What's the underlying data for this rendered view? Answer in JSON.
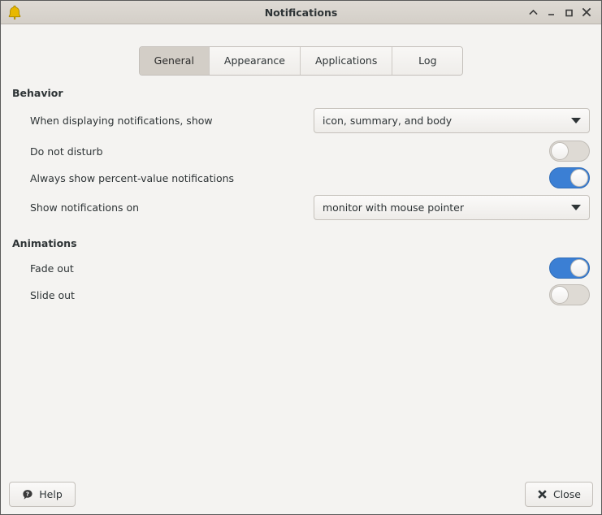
{
  "window": {
    "title": "Notifications",
    "icon": "bell-icon",
    "controls": [
      {
        "name": "shade-button",
        "glyph": "^"
      },
      {
        "name": "minimize-button",
        "glyph": "_"
      },
      {
        "name": "maximize-button",
        "glyph": "□"
      },
      {
        "name": "close-button",
        "glyph": "✕"
      }
    ]
  },
  "tabs": [
    {
      "label": "General",
      "active": true
    },
    {
      "label": "Appearance",
      "active": false
    },
    {
      "label": "Applications",
      "active": false
    },
    {
      "label": "Log",
      "active": false
    }
  ],
  "sections": {
    "behavior": {
      "title": "Behavior",
      "rows": {
        "display_show": {
          "label": "When displaying notifications, show",
          "control": "combobox",
          "value": "icon, summary, and body"
        },
        "do_not_disturb": {
          "label": "Do not disturb",
          "control": "switch",
          "value": "off"
        },
        "percent_value": {
          "label": "Always show percent-value notifications",
          "control": "switch",
          "value": "on"
        },
        "show_on": {
          "label": "Show notifications on",
          "control": "combobox",
          "value": "monitor with mouse pointer"
        }
      }
    },
    "animations": {
      "title": "Animations",
      "rows": {
        "fade_out": {
          "label": "Fade out",
          "control": "switch",
          "value": "on"
        },
        "slide_out": {
          "label": "Slide out",
          "control": "switch",
          "value": "off"
        }
      }
    }
  },
  "footer": {
    "help_label": "Help",
    "close_label": "Close"
  },
  "colors": {
    "accent_on": "#3b7fd4",
    "switch_off_track": "#dedad4",
    "titlebar": "#d6d2cc",
    "content_bg": "#f4f3f1",
    "tab_active": "#d3cec7",
    "bell": "#e8b800"
  }
}
